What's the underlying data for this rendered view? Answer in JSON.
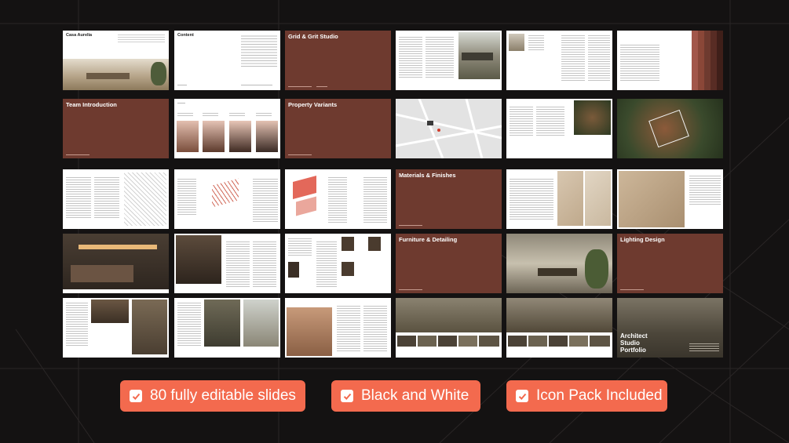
{
  "slides": {
    "casa_title": "Casa Aurelia",
    "content_title": "Content",
    "grid_grit": "Grid & Grit Studio",
    "team_intro": "Team Introduction",
    "property_variants": "Property Variants",
    "materials": "Materials & Finishes",
    "furniture": "Furniture & Detailing",
    "lighting": "Lighting Design",
    "portfolio_title": "Architect Studio Portfolio"
  },
  "badges": [
    {
      "label": "80 fully editable slides"
    },
    {
      "label": "Black and White"
    },
    {
      "label": "Icon Pack Included"
    }
  ],
  "colors": {
    "accent": "#f36a4e",
    "slide_brown": "#6e3a2f",
    "background": "#141212"
  },
  "icons": [
    "check-icon"
  ]
}
